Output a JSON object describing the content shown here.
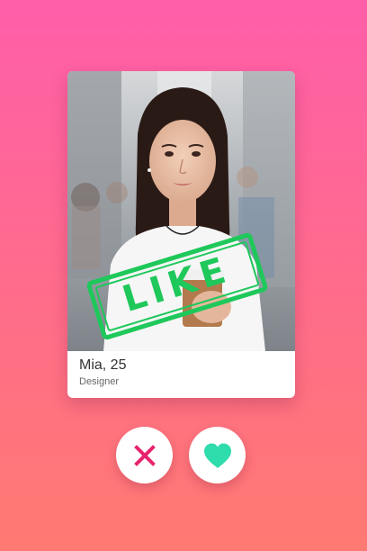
{
  "profile": {
    "name_age": "Mia, 25",
    "occupation": "Designer"
  },
  "stamp": {
    "label": "LIKE",
    "color": "#1ec85a"
  },
  "actions": {
    "dislike_icon": "x-icon",
    "like_icon": "heart-icon",
    "dislike_color": "#e8236f",
    "like_color": "#2fdcab"
  },
  "colors": {
    "background_top": "#ff5ea9",
    "background_bottom": "#ff7a72",
    "card": "#ffffff"
  }
}
